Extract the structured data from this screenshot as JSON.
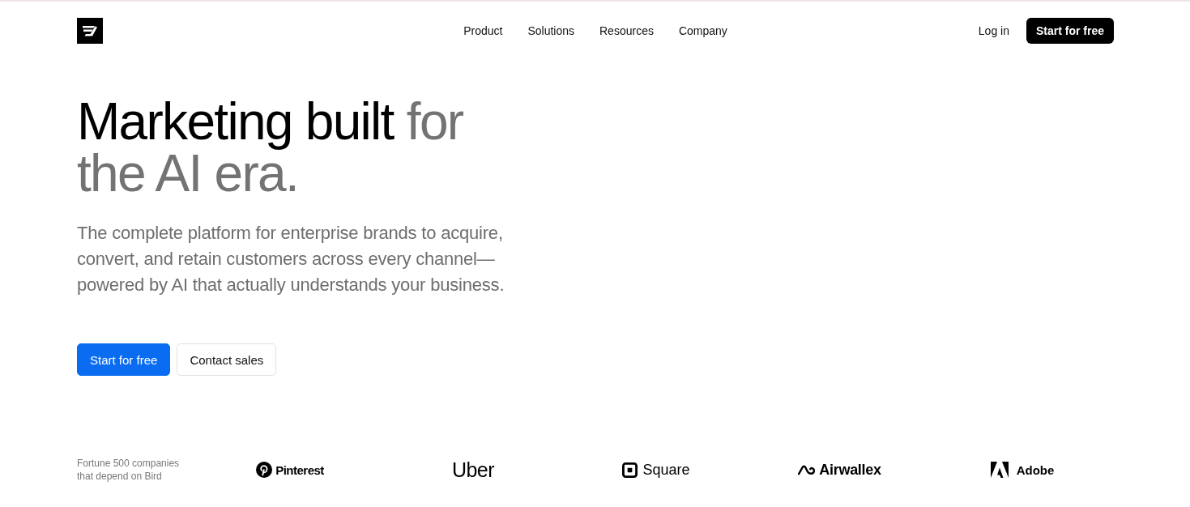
{
  "header": {
    "nav_links": [
      "Product",
      "Solutions",
      "Resources",
      "Company"
    ],
    "login": "Log in",
    "cta": "Start for free"
  },
  "hero": {
    "headline_dark": "Marketing built",
    "headline_light": "for the AI era.",
    "subtitle": "The complete platform for enterprise brands to acquire, convert, and retain customers across every channel—powered by AI that actually understands your business.",
    "buttons": [
      {
        "label": "Start for free",
        "kind": "primary"
      },
      {
        "label": "Contact sales",
        "kind": "secondary"
      }
    ]
  },
  "customers": {
    "caption": "Fortune 500 companies that depend on Bird",
    "logos": [
      {
        "name": "Pinterest",
        "kind": "pin"
      },
      {
        "name": "Uber",
        "kind": "plain"
      },
      {
        "name": "Square",
        "kind": "square"
      },
      {
        "name": "Airwallex",
        "kind": "wave"
      },
      {
        "name": "Adobe",
        "kind": "triangle"
      }
    ]
  }
}
